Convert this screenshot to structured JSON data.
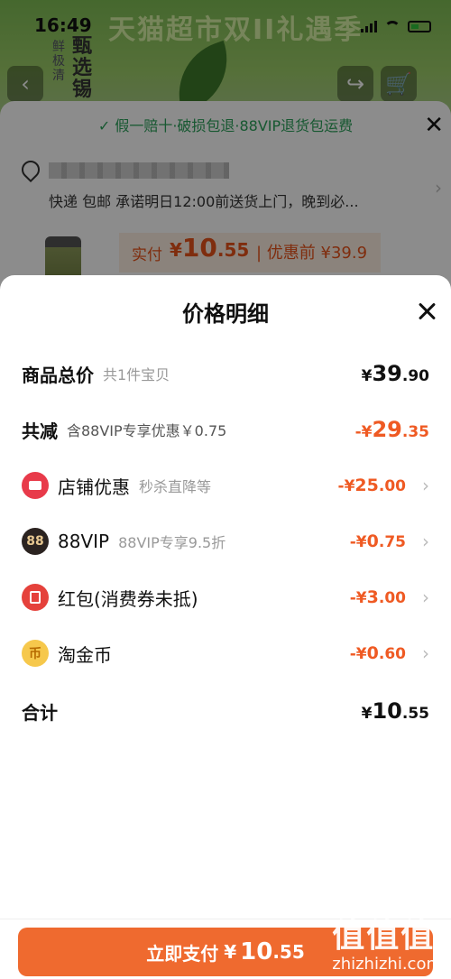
{
  "status": {
    "time": "16:49"
  },
  "background": {
    "banner_text": "天猫超市双II礼遇季",
    "side_text": "鲜极清",
    "brand_text": "甄选锡",
    "guarantee": "假一赔十·破损包退·88VIP退货包运费",
    "delivery": "快递 包邮 承诺明日12:00前送货上门，晚到必...",
    "pay_label": "实付",
    "pay_currency": "¥",
    "pay_int": "10",
    "pay_dec": ".55",
    "before_discount": "| 优惠前 ¥39.9"
  },
  "sheet": {
    "title": "价格明细",
    "rows": [
      {
        "label": "商品总价",
        "sub": "共1件宝贝",
        "cur": "¥",
        "int": "39",
        "dec": ".90"
      },
      {
        "label": "共减",
        "sub": "含88VIP专享优惠￥0.75",
        "cur": "-¥",
        "int": "29",
        "dec": ".35"
      },
      {
        "label": "店铺优惠",
        "sub": "秒杀直降等",
        "cur": "-¥",
        "int": "25",
        "dec": ".00"
      },
      {
        "label": "88VIP",
        "sub": "88VIP专享9.5折",
        "cur": "-¥",
        "int": "0",
        "dec": ".75",
        "icon_text": "88"
      },
      {
        "label": "红包(消费券未抵)",
        "sub": "",
        "cur": "-¥",
        "int": "3",
        "dec": ".00"
      },
      {
        "label": "淘金币",
        "sub": "",
        "cur": "-¥",
        "int": "0",
        "dec": ".60",
        "icon_text": "币"
      },
      {
        "label": "合计",
        "sub": "",
        "cur": "¥",
        "int": "10",
        "dec": ".55"
      }
    ]
  },
  "pay_button": {
    "label": "立即支付",
    "cur": "¥",
    "int": "10",
    "dec": ".55"
  },
  "watermark": {
    "logo": "值值值",
    "url": "zhizhizhi.com"
  },
  "colors": {
    "accent": "#ef6a2f",
    "discount": "#ef5a23",
    "guarantee": "#2aa05a"
  },
  "icons": [
    "back-icon",
    "share-icon",
    "cart-icon",
    "close-icon",
    "location-icon",
    "shop-coupon-icon",
    "vip-icon",
    "red-packet-icon",
    "gold-coin-icon",
    "chevron-right-icon"
  ]
}
